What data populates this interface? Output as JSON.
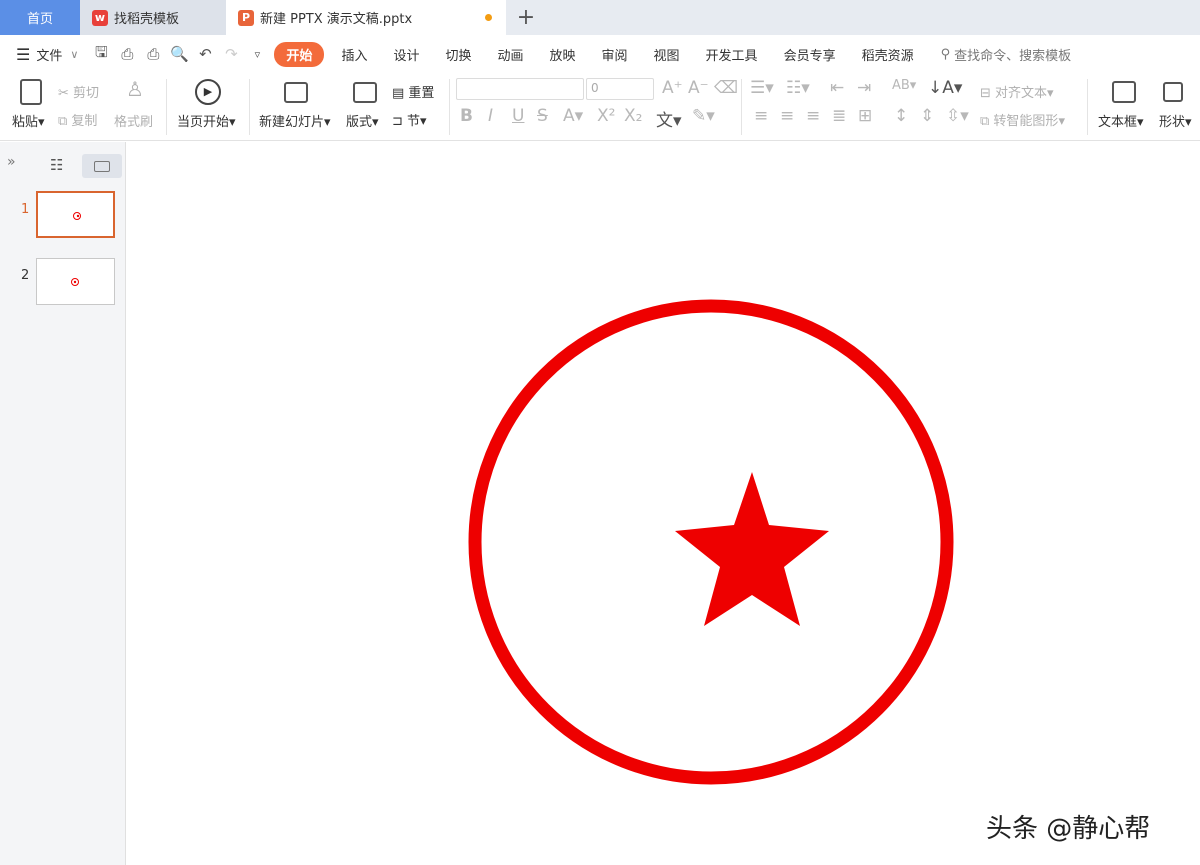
{
  "tabs": {
    "home": "首页",
    "template": "找稻壳模板",
    "document": "新建 PPTX 演示文稿.pptx",
    "new_tab": "+"
  },
  "menu": {
    "file": "文件",
    "items": [
      "开始",
      "插入",
      "设计",
      "切换",
      "动画",
      "放映",
      "审阅",
      "视图",
      "开发工具",
      "会员专享",
      "稻壳资源"
    ],
    "active_index": 0,
    "search_placeholder": "查找命令、搜索模板"
  },
  "ribbon": {
    "paste": "粘贴",
    "cut": "剪切",
    "copy": "复制",
    "format_painter": "格式刷",
    "play_from_current": "当页开始",
    "new_slide": "新建幻灯片",
    "layout": "版式",
    "reset": "重置",
    "section": "节",
    "font_size": "0",
    "align_text": "对齐文本",
    "convert_smartart": "转智能图形",
    "text_box": "文本框",
    "shape": "形状"
  },
  "slides": {
    "items": [
      {
        "number": "1",
        "selected": true
      },
      {
        "number": "2",
        "selected": false
      }
    ]
  },
  "canvas": {
    "shape_color": "#ee0000",
    "content": "red circle with five-pointed star"
  },
  "watermark": "头条 @静心帮",
  "colors": {
    "accent": "#f36b3b",
    "home_tab": "#5b8fe6",
    "selected_slide": "#d9652f"
  }
}
